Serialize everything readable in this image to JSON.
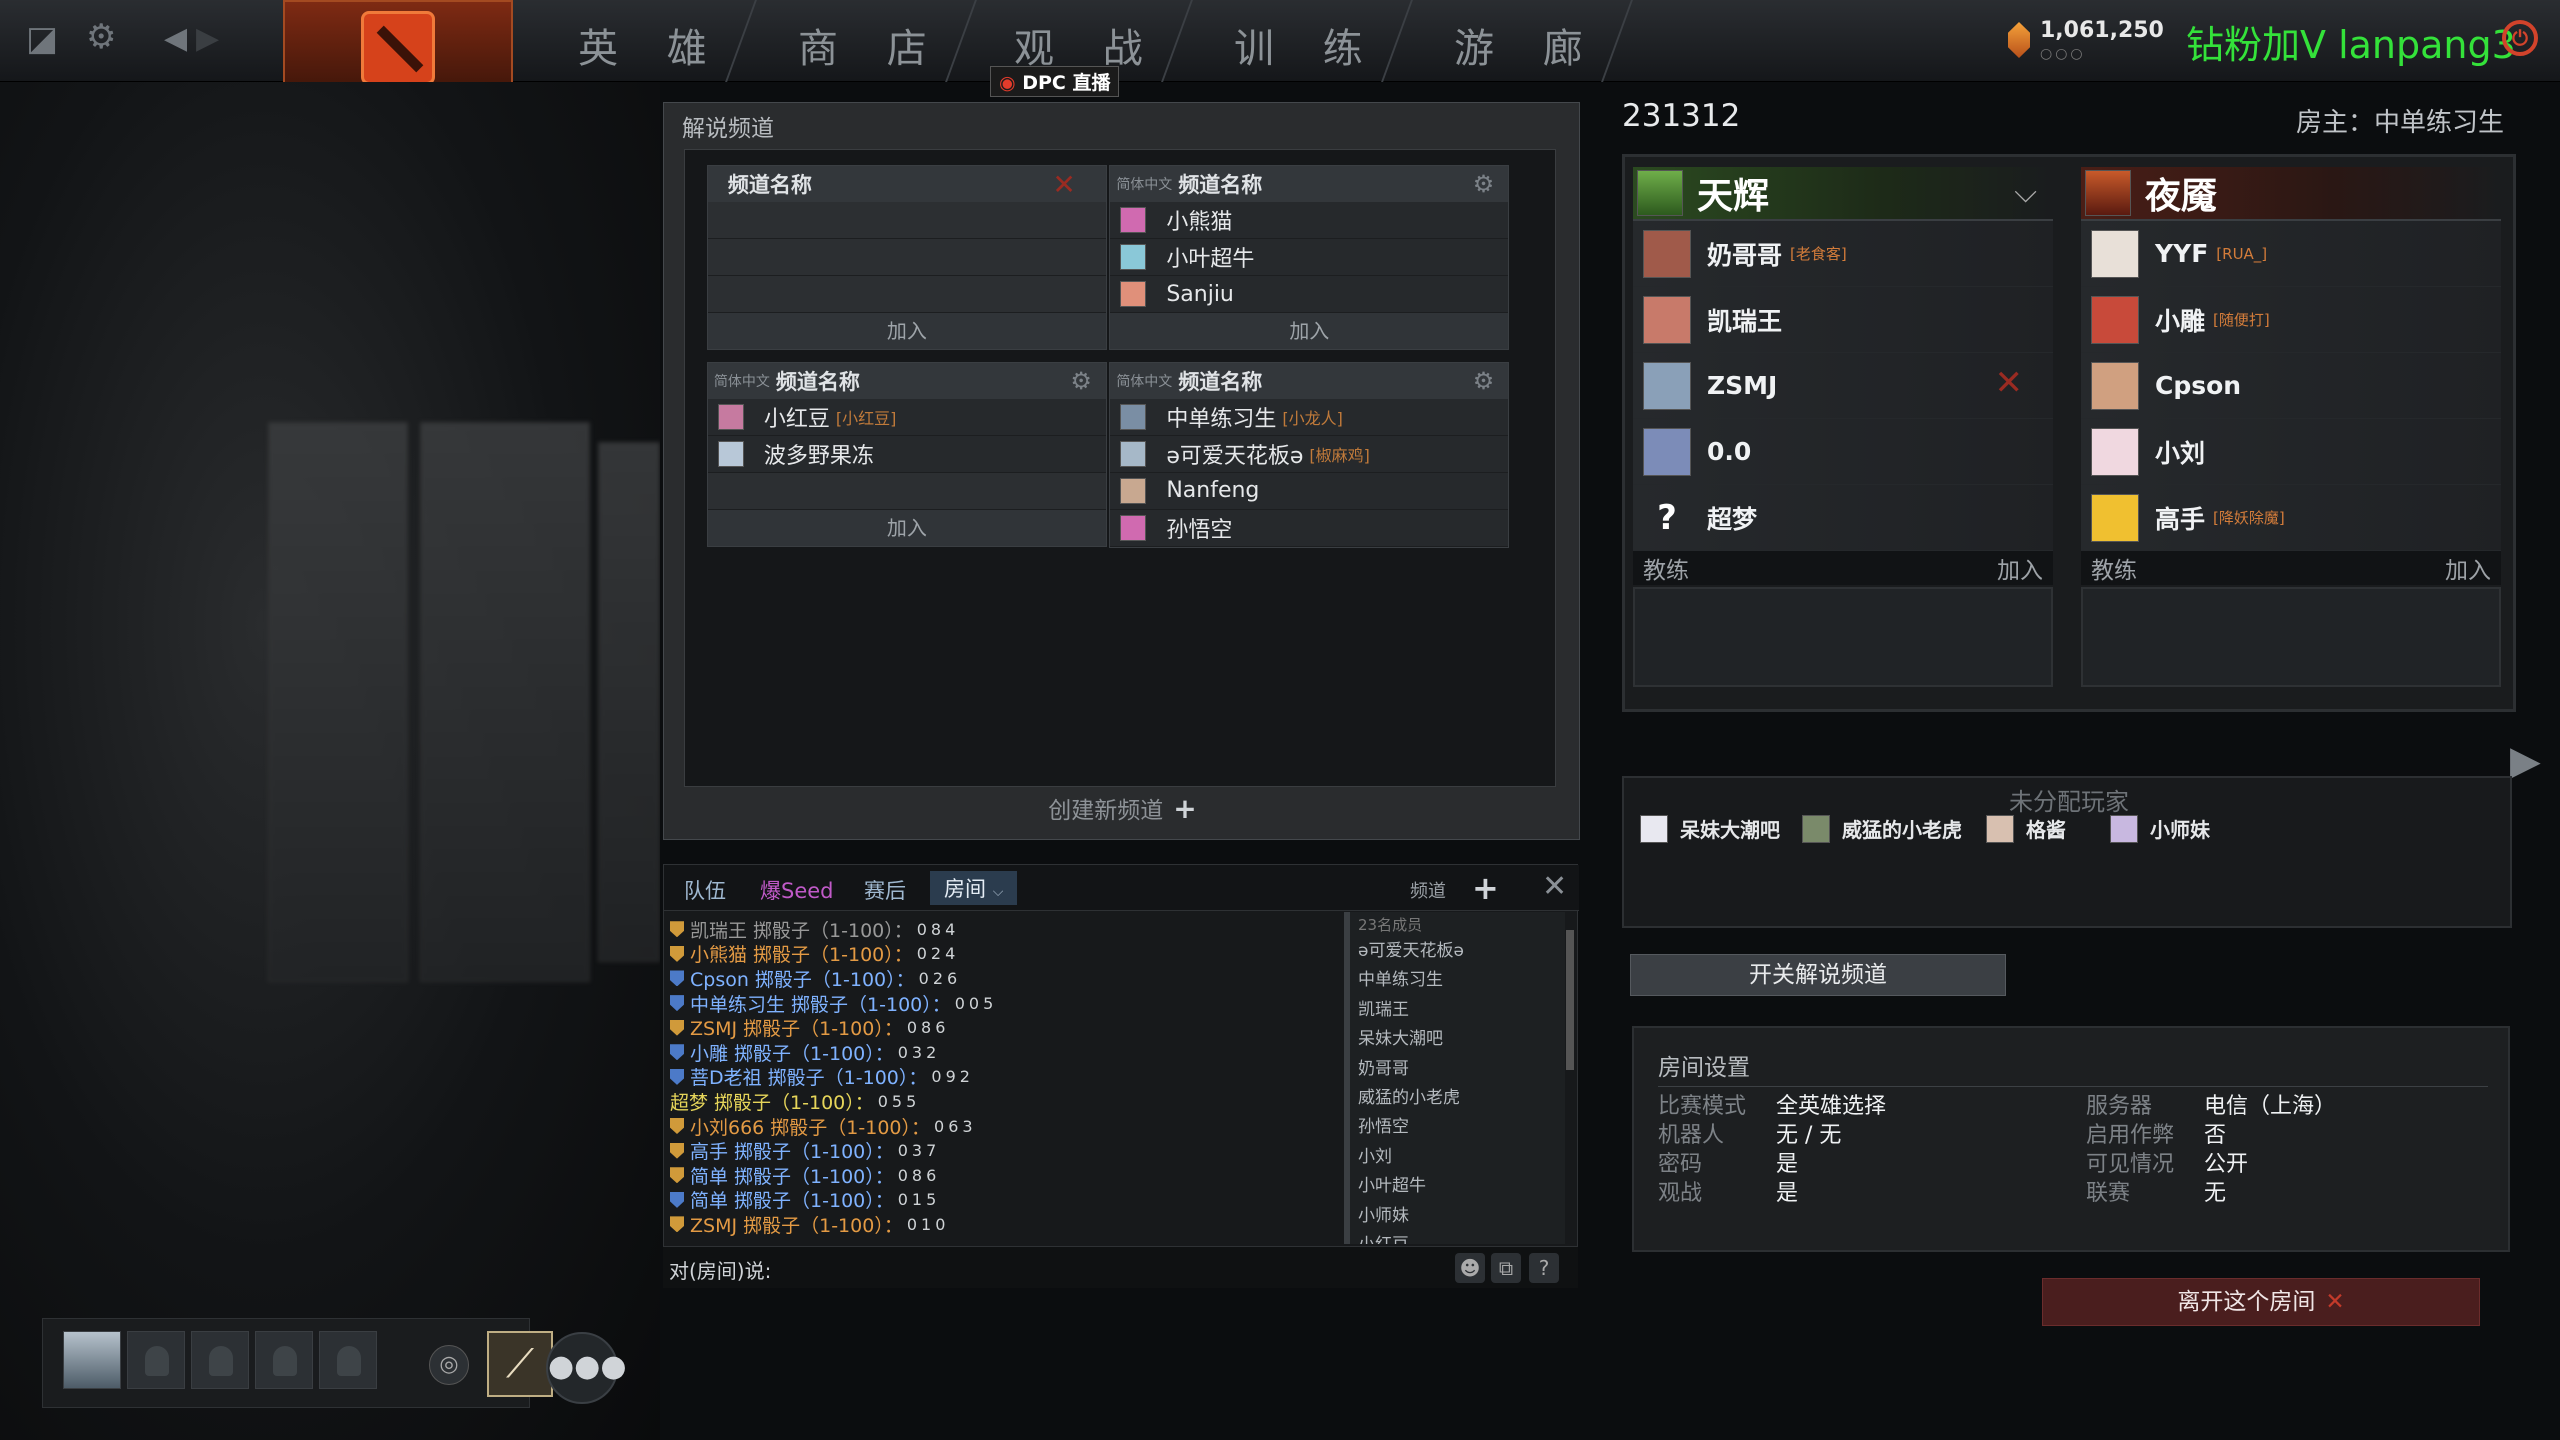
{
  "topbar": {
    "nav": [
      "英 雄",
      "商 店",
      "观 战",
      "训 练",
      "游 廊"
    ],
    "dpc_badge": "DPC 直播",
    "shards": "1,061,250",
    "promo": "钻粉加V lanpang3"
  },
  "broadcast": {
    "title": "解说频道",
    "channels": [
      {
        "lang": "",
        "name": "频道名称",
        "members": [],
        "join": "加入",
        "action": "close"
      },
      {
        "lang": "简体中文",
        "name": "频道名称",
        "members": [
          {
            "name": "小熊猫",
            "tag": ""
          },
          {
            "name": "小叶超牛",
            "tag": ""
          },
          {
            "name": "Sanjiu",
            "tag": ""
          }
        ],
        "join": "加入",
        "action": "gear"
      },
      {
        "lang": "简体中文",
        "name": "频道名称",
        "members": [
          {
            "name": "小红豆",
            "tag": "[小红豆]"
          },
          {
            "name": "波多野果冻",
            "tag": ""
          }
        ],
        "join": "加入",
        "action": "gear"
      },
      {
        "lang": "简体中文",
        "name": "频道名称",
        "members": [
          {
            "name": "中单练习生",
            "tag": "[小龙人]"
          },
          {
            "name": "ə可爱天花板ə",
            "tag": "[椒麻鸡]"
          },
          {
            "name": "Nanfeng",
            "tag": ""
          },
          {
            "name": "孙悟空",
            "tag": ""
          }
        ],
        "join": "",
        "action": "gear"
      }
    ],
    "create": "创建新频道"
  },
  "chat": {
    "tabs": [
      "队伍",
      "爆Seed",
      "赛后",
      "房间"
    ],
    "channel_label": "频道",
    "log": [
      {
        "shield": "gold",
        "color": "c-gray",
        "text": "凯瑞王 掷骰子（1-100）：",
        "result": "084"
      },
      {
        "shield": "gold",
        "color": "c-orange",
        "text": "小熊猫 掷骰子（1-100）：",
        "result": "024"
      },
      {
        "shield": "blue",
        "color": "c-blue",
        "text": "Cpson 掷骰子（1-100）：",
        "result": "026"
      },
      {
        "shield": "blue",
        "color": "c-blue",
        "text": "中单练习生 掷骰子（1-100）：",
        "result": "005"
      },
      {
        "shield": "gold",
        "color": "c-orange",
        "text": "ZSMJ 掷骰子（1-100）：",
        "result": "086"
      },
      {
        "shield": "blue",
        "color": "c-blue",
        "text": "小雕 掷骰子（1-100）：",
        "result": "032"
      },
      {
        "shield": "blue",
        "color": "c-blue",
        "text": "菩D老祖 掷骰子（1-100）：",
        "result": "092"
      },
      {
        "shield": "",
        "color": "c-yellow",
        "text": "超梦 掷骰子（1-100）：",
        "result": "055"
      },
      {
        "shield": "gold",
        "color": "c-orange",
        "text": "小刘666 掷骰子（1-100）：",
        "result": "063"
      },
      {
        "shield": "gold",
        "color": "c-blue",
        "text": "高手 掷骰子（1-100）：",
        "result": "037"
      },
      {
        "shield": "gold",
        "color": "c-blue",
        "text": "简单 掷骰子（1-100）：",
        "result": "086"
      },
      {
        "shield": "blue",
        "color": "c-blue",
        "text": "简单 掷骰子（1-100）：",
        "result": "015"
      },
      {
        "shield": "gold",
        "color": "c-orange",
        "text": "ZSMJ 掷骰子（1-100）：",
        "result": "010"
      }
    ],
    "member_count": "23名成员",
    "members": [
      "ə可爱天花板ə",
      "中单练习生",
      "凯瑞王",
      "呆妹大潮吧",
      "奶哥哥",
      "威猛的小老虎",
      "孙悟空",
      "小刘",
      "小叶超牛",
      "小师妹",
      "小红豆"
    ],
    "input_prompt": "对(房间)说:"
  },
  "lobby": {
    "id": "231312",
    "host": "房主：中单练习生",
    "radiant": {
      "name": "天辉",
      "players": [
        {
          "name": "奶哥哥",
          "tag": "[老食客]",
          "kick": false
        },
        {
          "name": "凯瑞王",
          "tag": "",
          "kick": false
        },
        {
          "name": "ZSMJ",
          "tag": "",
          "kick": true
        },
        {
          "name": "0.0",
          "tag": "",
          "kick": false
        },
        {
          "name": "超梦",
          "tag": "",
          "kick": false,
          "unknown": true
        }
      ],
      "coach": "教练",
      "join": "加入"
    },
    "dire": {
      "name": "夜魇",
      "players": [
        {
          "name": "YYF",
          "tag": "[RUA_]",
          "kick": false
        },
        {
          "name": "小雕",
          "tag": "[随便打]",
          "kick": false
        },
        {
          "name": "Cpson",
          "tag": "",
          "kick": false
        },
        {
          "name": "小刘",
          "tag": "",
          "kick": false
        },
        {
          "name": "高手",
          "tag": "[降妖除魔]",
          "kick": false
        }
      ],
      "coach": "教练",
      "join": "加入"
    },
    "unassigned_title": "未分配玩家",
    "unassigned": [
      "呆妹大潮吧",
      "威猛的小老虎",
      "格酱",
      "小师妹"
    ],
    "toggle_broadcast": "开关解说频道",
    "settings": {
      "title": "房间设置",
      "rows": [
        {
          "k": "比赛模式",
          "v": "全英雄选择"
        },
        {
          "k": "机器人",
          "v": "无 / 无"
        },
        {
          "k": "密码",
          "v": "是"
        },
        {
          "k": "观战",
          "v": "是"
        },
        {
          "k": "服务器",
          "v": "电信（上海）"
        },
        {
          "k": "启用作弊",
          "v": "否"
        },
        {
          "k": "可见情况",
          "v": "公开"
        },
        {
          "k": "联赛",
          "v": "无"
        }
      ]
    },
    "leave": "离开这个房间"
  },
  "colors": {
    "radiant": "#2b4a20",
    "dire": "#4a1e16",
    "promo": "#34e23a",
    "kick": "#9a2b22"
  }
}
